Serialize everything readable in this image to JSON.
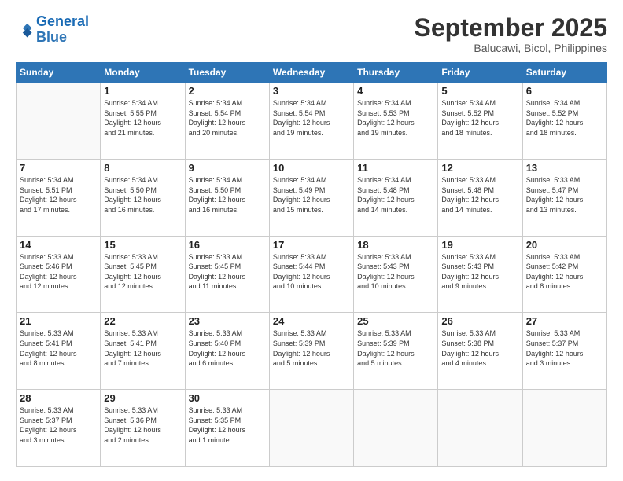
{
  "header": {
    "logo_line1": "General",
    "logo_line2": "Blue",
    "month": "September 2025",
    "location": "Balucawi, Bicol, Philippines"
  },
  "weekdays": [
    "Sunday",
    "Monday",
    "Tuesday",
    "Wednesday",
    "Thursday",
    "Friday",
    "Saturday"
  ],
  "weeks": [
    [
      {
        "day": "",
        "info": ""
      },
      {
        "day": "1",
        "info": "Sunrise: 5:34 AM\nSunset: 5:55 PM\nDaylight: 12 hours\nand 21 minutes."
      },
      {
        "day": "2",
        "info": "Sunrise: 5:34 AM\nSunset: 5:54 PM\nDaylight: 12 hours\nand 20 minutes."
      },
      {
        "day": "3",
        "info": "Sunrise: 5:34 AM\nSunset: 5:54 PM\nDaylight: 12 hours\nand 19 minutes."
      },
      {
        "day": "4",
        "info": "Sunrise: 5:34 AM\nSunset: 5:53 PM\nDaylight: 12 hours\nand 19 minutes."
      },
      {
        "day": "5",
        "info": "Sunrise: 5:34 AM\nSunset: 5:52 PM\nDaylight: 12 hours\nand 18 minutes."
      },
      {
        "day": "6",
        "info": "Sunrise: 5:34 AM\nSunset: 5:52 PM\nDaylight: 12 hours\nand 18 minutes."
      }
    ],
    [
      {
        "day": "7",
        "info": "Sunrise: 5:34 AM\nSunset: 5:51 PM\nDaylight: 12 hours\nand 17 minutes."
      },
      {
        "day": "8",
        "info": "Sunrise: 5:34 AM\nSunset: 5:50 PM\nDaylight: 12 hours\nand 16 minutes."
      },
      {
        "day": "9",
        "info": "Sunrise: 5:34 AM\nSunset: 5:50 PM\nDaylight: 12 hours\nand 16 minutes."
      },
      {
        "day": "10",
        "info": "Sunrise: 5:34 AM\nSunset: 5:49 PM\nDaylight: 12 hours\nand 15 minutes."
      },
      {
        "day": "11",
        "info": "Sunrise: 5:34 AM\nSunset: 5:48 PM\nDaylight: 12 hours\nand 14 minutes."
      },
      {
        "day": "12",
        "info": "Sunrise: 5:33 AM\nSunset: 5:48 PM\nDaylight: 12 hours\nand 14 minutes."
      },
      {
        "day": "13",
        "info": "Sunrise: 5:33 AM\nSunset: 5:47 PM\nDaylight: 12 hours\nand 13 minutes."
      }
    ],
    [
      {
        "day": "14",
        "info": "Sunrise: 5:33 AM\nSunset: 5:46 PM\nDaylight: 12 hours\nand 12 minutes."
      },
      {
        "day": "15",
        "info": "Sunrise: 5:33 AM\nSunset: 5:45 PM\nDaylight: 12 hours\nand 12 minutes."
      },
      {
        "day": "16",
        "info": "Sunrise: 5:33 AM\nSunset: 5:45 PM\nDaylight: 12 hours\nand 11 minutes."
      },
      {
        "day": "17",
        "info": "Sunrise: 5:33 AM\nSunset: 5:44 PM\nDaylight: 12 hours\nand 10 minutes."
      },
      {
        "day": "18",
        "info": "Sunrise: 5:33 AM\nSunset: 5:43 PM\nDaylight: 12 hours\nand 10 minutes."
      },
      {
        "day": "19",
        "info": "Sunrise: 5:33 AM\nSunset: 5:43 PM\nDaylight: 12 hours\nand 9 minutes."
      },
      {
        "day": "20",
        "info": "Sunrise: 5:33 AM\nSunset: 5:42 PM\nDaylight: 12 hours\nand 8 minutes."
      }
    ],
    [
      {
        "day": "21",
        "info": "Sunrise: 5:33 AM\nSunset: 5:41 PM\nDaylight: 12 hours\nand 8 minutes."
      },
      {
        "day": "22",
        "info": "Sunrise: 5:33 AM\nSunset: 5:41 PM\nDaylight: 12 hours\nand 7 minutes."
      },
      {
        "day": "23",
        "info": "Sunrise: 5:33 AM\nSunset: 5:40 PM\nDaylight: 12 hours\nand 6 minutes."
      },
      {
        "day": "24",
        "info": "Sunrise: 5:33 AM\nSunset: 5:39 PM\nDaylight: 12 hours\nand 5 minutes."
      },
      {
        "day": "25",
        "info": "Sunrise: 5:33 AM\nSunset: 5:39 PM\nDaylight: 12 hours\nand 5 minutes."
      },
      {
        "day": "26",
        "info": "Sunrise: 5:33 AM\nSunset: 5:38 PM\nDaylight: 12 hours\nand 4 minutes."
      },
      {
        "day": "27",
        "info": "Sunrise: 5:33 AM\nSunset: 5:37 PM\nDaylight: 12 hours\nand 3 minutes."
      }
    ],
    [
      {
        "day": "28",
        "info": "Sunrise: 5:33 AM\nSunset: 5:37 PM\nDaylight: 12 hours\nand 3 minutes."
      },
      {
        "day": "29",
        "info": "Sunrise: 5:33 AM\nSunset: 5:36 PM\nDaylight: 12 hours\nand 2 minutes."
      },
      {
        "day": "30",
        "info": "Sunrise: 5:33 AM\nSunset: 5:35 PM\nDaylight: 12 hours\nand 1 minute."
      },
      {
        "day": "",
        "info": ""
      },
      {
        "day": "",
        "info": ""
      },
      {
        "day": "",
        "info": ""
      },
      {
        "day": "",
        "info": ""
      }
    ]
  ]
}
